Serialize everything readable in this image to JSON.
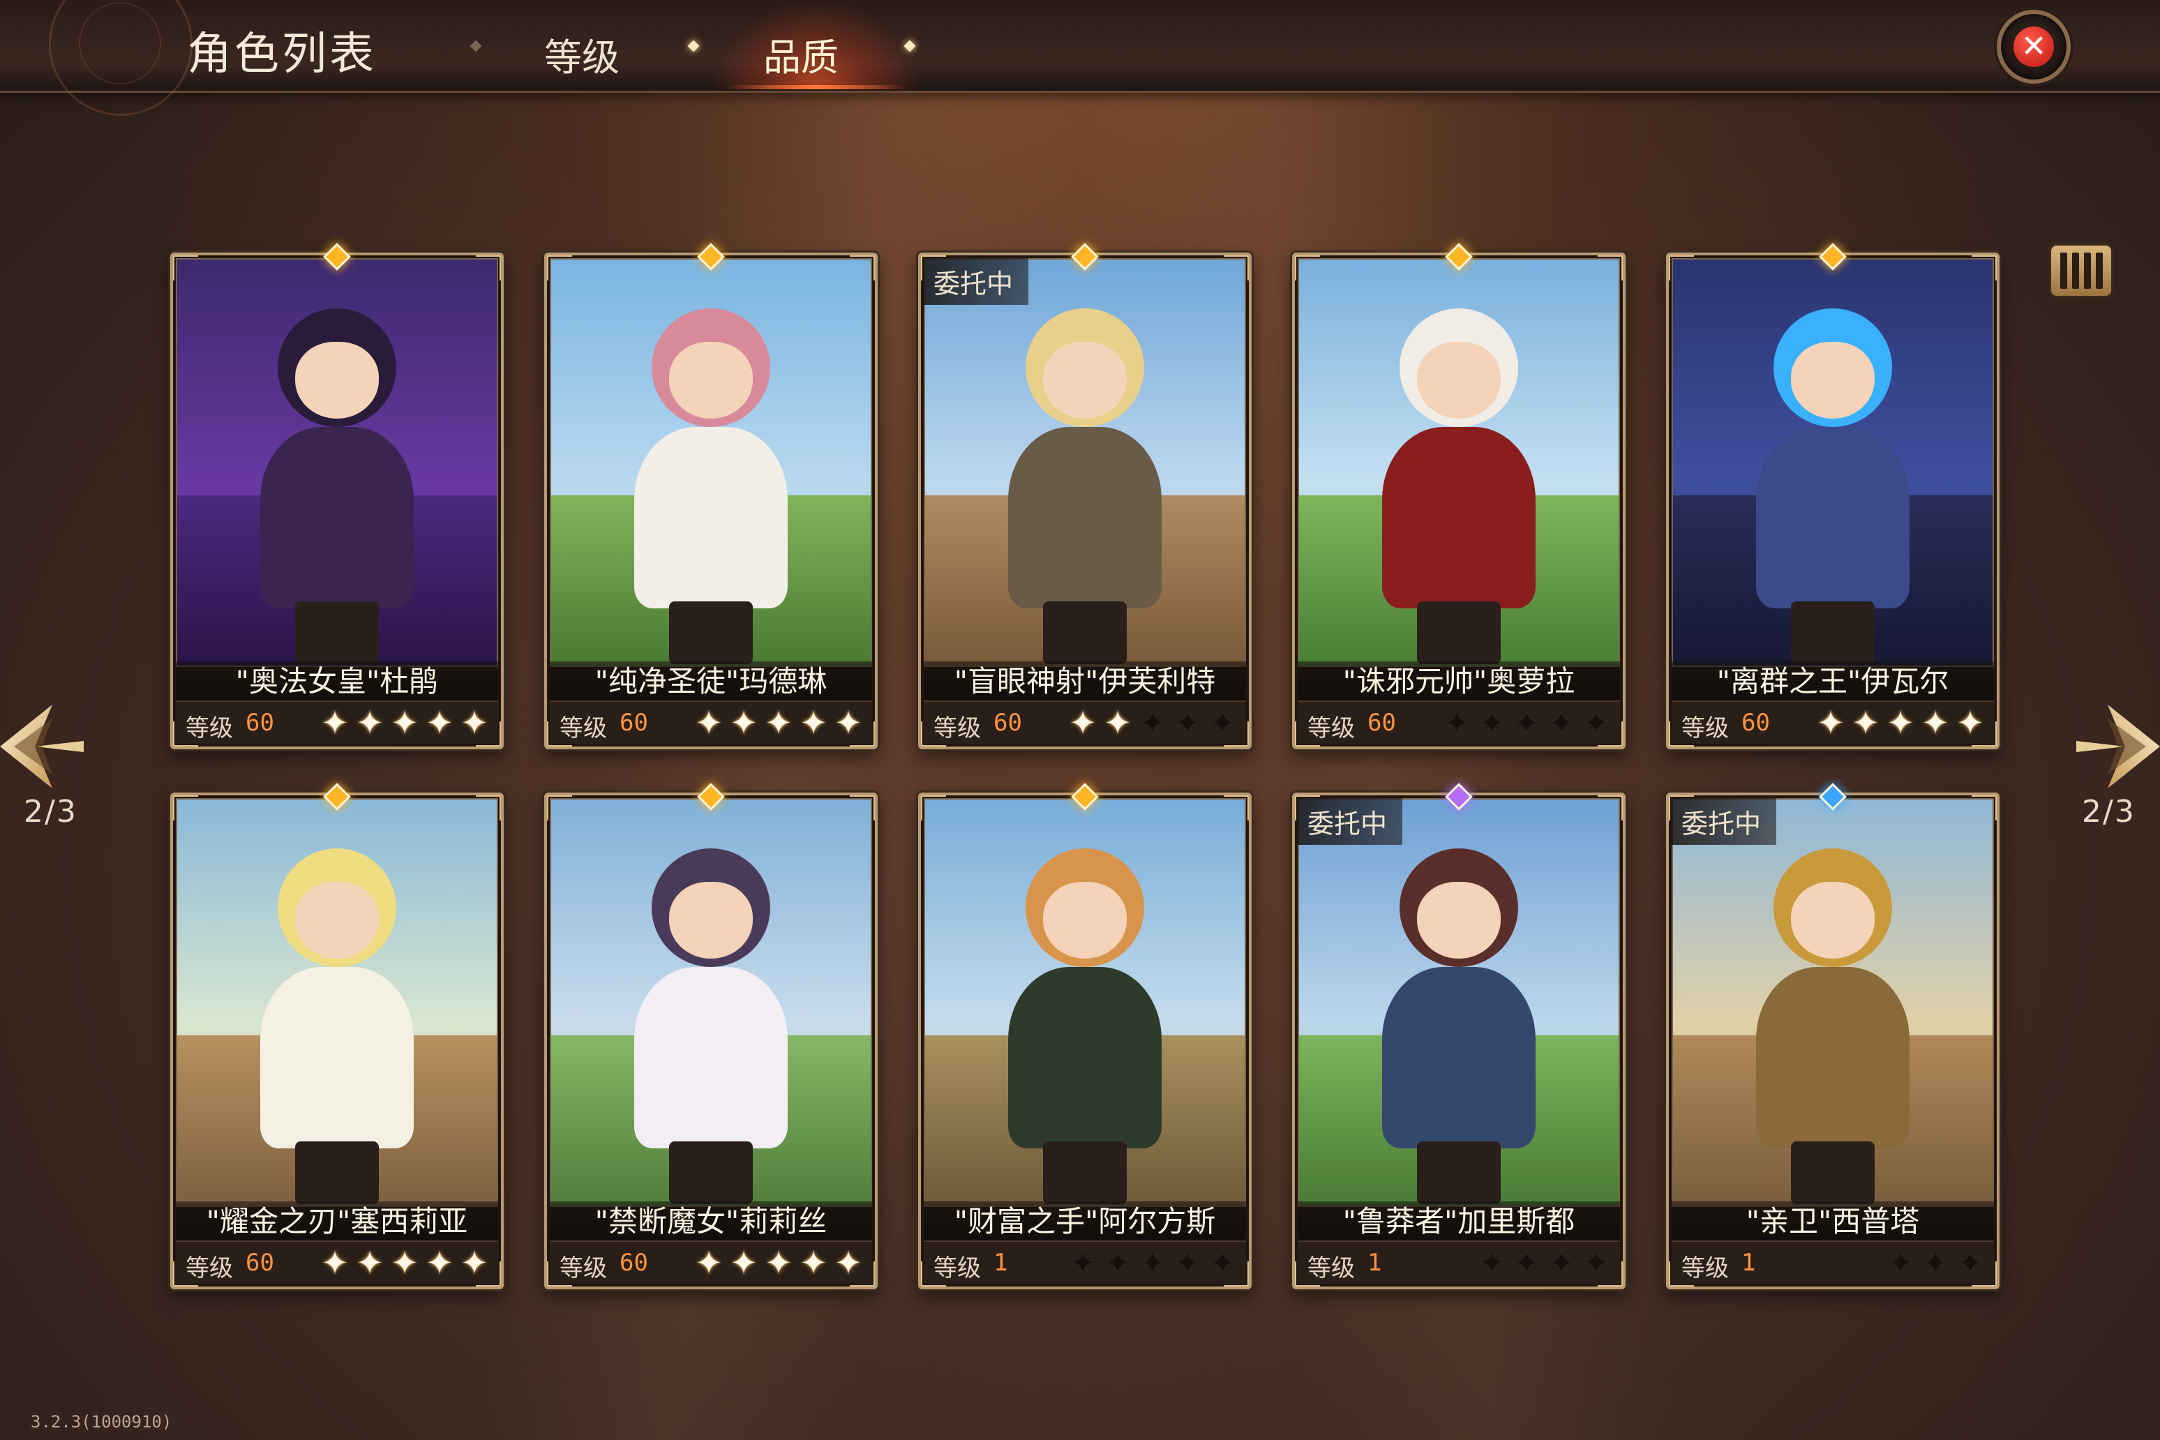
{
  "header": {
    "title": "角色列表",
    "tabs": [
      {
        "label": "等级",
        "active": false
      },
      {
        "label": "品质",
        "active": true
      }
    ]
  },
  "pagination": {
    "left_indicator": "2/3",
    "right_indicator": "2/3"
  },
  "version": "3.2.3(1000910)",
  "colors": {
    "level_value": "#ff9440",
    "badge_gold": "#ffb524",
    "badge_purple": "#b66bff",
    "badge_blue": "#3aa6ff",
    "close_red": "#d42a22"
  },
  "icons": {
    "close": "close-icon",
    "filter": "filter-icon",
    "prev": "prev-page-icon",
    "next": "next-page-icon"
  },
  "level_label": "等级",
  "cards": [
    {
      "name": "\"奥法女皇\"杜鹃",
      "level": "60",
      "stars_lit": 5,
      "stars_total": 5,
      "entrust": "",
      "rarity": "gold"
    },
    {
      "name": "\"纯净圣徒\"玛德琳",
      "level": "60",
      "stars_lit": 5,
      "stars_total": 5,
      "entrust": "",
      "rarity": "gold"
    },
    {
      "name": "\"盲眼神射\"伊芙利特",
      "level": "60",
      "stars_lit": 2,
      "stars_total": 5,
      "entrust": "委托中",
      "rarity": "gold"
    },
    {
      "name": "\"诛邪元帅\"奥萝拉",
      "level": "60",
      "stars_lit": 0,
      "stars_total": 5,
      "entrust": "",
      "rarity": "gold"
    },
    {
      "name": "\"离群之王\"伊瓦尔",
      "level": "60",
      "stars_lit": 5,
      "stars_total": 5,
      "entrust": "",
      "rarity": "gold"
    },
    {
      "name": "\"耀金之刃\"塞西莉亚",
      "level": "60",
      "stars_lit": 5,
      "stars_total": 5,
      "entrust": "",
      "rarity": "gold"
    },
    {
      "name": "\"禁断魔女\"莉莉丝",
      "level": "60",
      "stars_lit": 5,
      "stars_total": 5,
      "entrust": "",
      "rarity": "gold"
    },
    {
      "name": "\"财富之手\"阿尔方斯",
      "level": "1",
      "stars_lit": 0,
      "stars_total": 5,
      "entrust": "",
      "rarity": "gold"
    },
    {
      "name": "\"鲁莽者\"加里斯都",
      "level": "1",
      "stars_lit": 0,
      "stars_total": 4,
      "entrust": "委托中",
      "rarity": "purple"
    },
    {
      "name": "\"亲卫\"西普塔",
      "level": "1",
      "stars_lit": 0,
      "stars_total": 3,
      "entrust": "委托中",
      "rarity": "blue"
    }
  ]
}
